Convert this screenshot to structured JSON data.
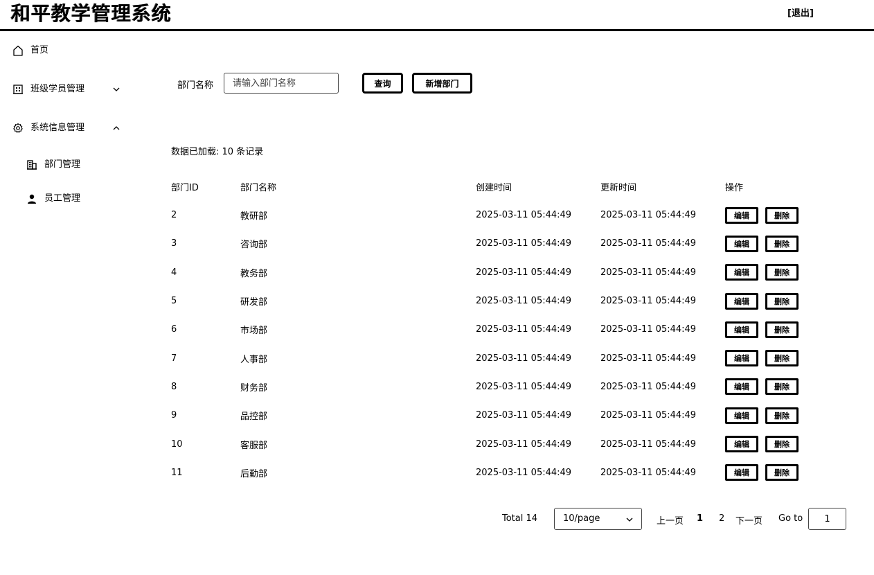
{
  "header": {
    "title": "和平教学管理系统",
    "logout_label": "[退出]"
  },
  "sidebar": {
    "items": [
      {
        "label": "首页",
        "icon": "home-icon"
      },
      {
        "label": "班级学员管理",
        "icon": "building-icon",
        "expanded": false
      },
      {
        "label": "系统信息管理",
        "icon": "gear-icon",
        "expanded": true,
        "children": [
          {
            "label": "部门管理",
            "icon": "office-icon"
          },
          {
            "label": "员工管理",
            "icon": "user-icon"
          }
        ]
      }
    ]
  },
  "search": {
    "label": "部门名称",
    "placeholder": "请输入部门名称",
    "value": "",
    "query_label": "查询",
    "add_label": "新增部门"
  },
  "status_text": "数据已加载: 10 条记录",
  "table": {
    "columns": [
      "部门ID",
      "部门名称",
      "创建时间",
      "更新时间",
      "操作"
    ],
    "edit_label": "编辑",
    "delete_label": "删除",
    "rows": [
      {
        "id": "2",
        "name": "教研部",
        "created": "2025-03-11 05:44:49",
        "updated": "2025-03-11 05:44:49"
      },
      {
        "id": "3",
        "name": "咨询部",
        "created": "2025-03-11 05:44:49",
        "updated": "2025-03-11 05:44:49"
      },
      {
        "id": "4",
        "name": "教务部",
        "created": "2025-03-11 05:44:49",
        "updated": "2025-03-11 05:44:49"
      },
      {
        "id": "5",
        "name": "研发部",
        "created": "2025-03-11 05:44:49",
        "updated": "2025-03-11 05:44:49"
      },
      {
        "id": "6",
        "name": "市场部",
        "created": "2025-03-11 05:44:49",
        "updated": "2025-03-11 05:44:49"
      },
      {
        "id": "7",
        "name": "人事部",
        "created": "2025-03-11 05:44:49",
        "updated": "2025-03-11 05:44:49"
      },
      {
        "id": "8",
        "name": "财务部",
        "created": "2025-03-11 05:44:49",
        "updated": "2025-03-11 05:44:49"
      },
      {
        "id": "9",
        "name": "品控部",
        "created": "2025-03-11 05:44:49",
        "updated": "2025-03-11 05:44:49"
      },
      {
        "id": "10",
        "name": "客服部",
        "created": "2025-03-11 05:44:49",
        "updated": "2025-03-11 05:44:49"
      },
      {
        "id": "11",
        "name": "后勤部",
        "created": "2025-03-11 05:44:49",
        "updated": "2025-03-11 05:44:49"
      }
    ]
  },
  "pagination": {
    "total_text": "Total 14",
    "page_size": "10/page",
    "prev_label": "上一页",
    "pages": [
      "1",
      "2"
    ],
    "current_page": "1",
    "next_label": "下一页",
    "goto_label": "Go to",
    "goto_value": "1"
  }
}
